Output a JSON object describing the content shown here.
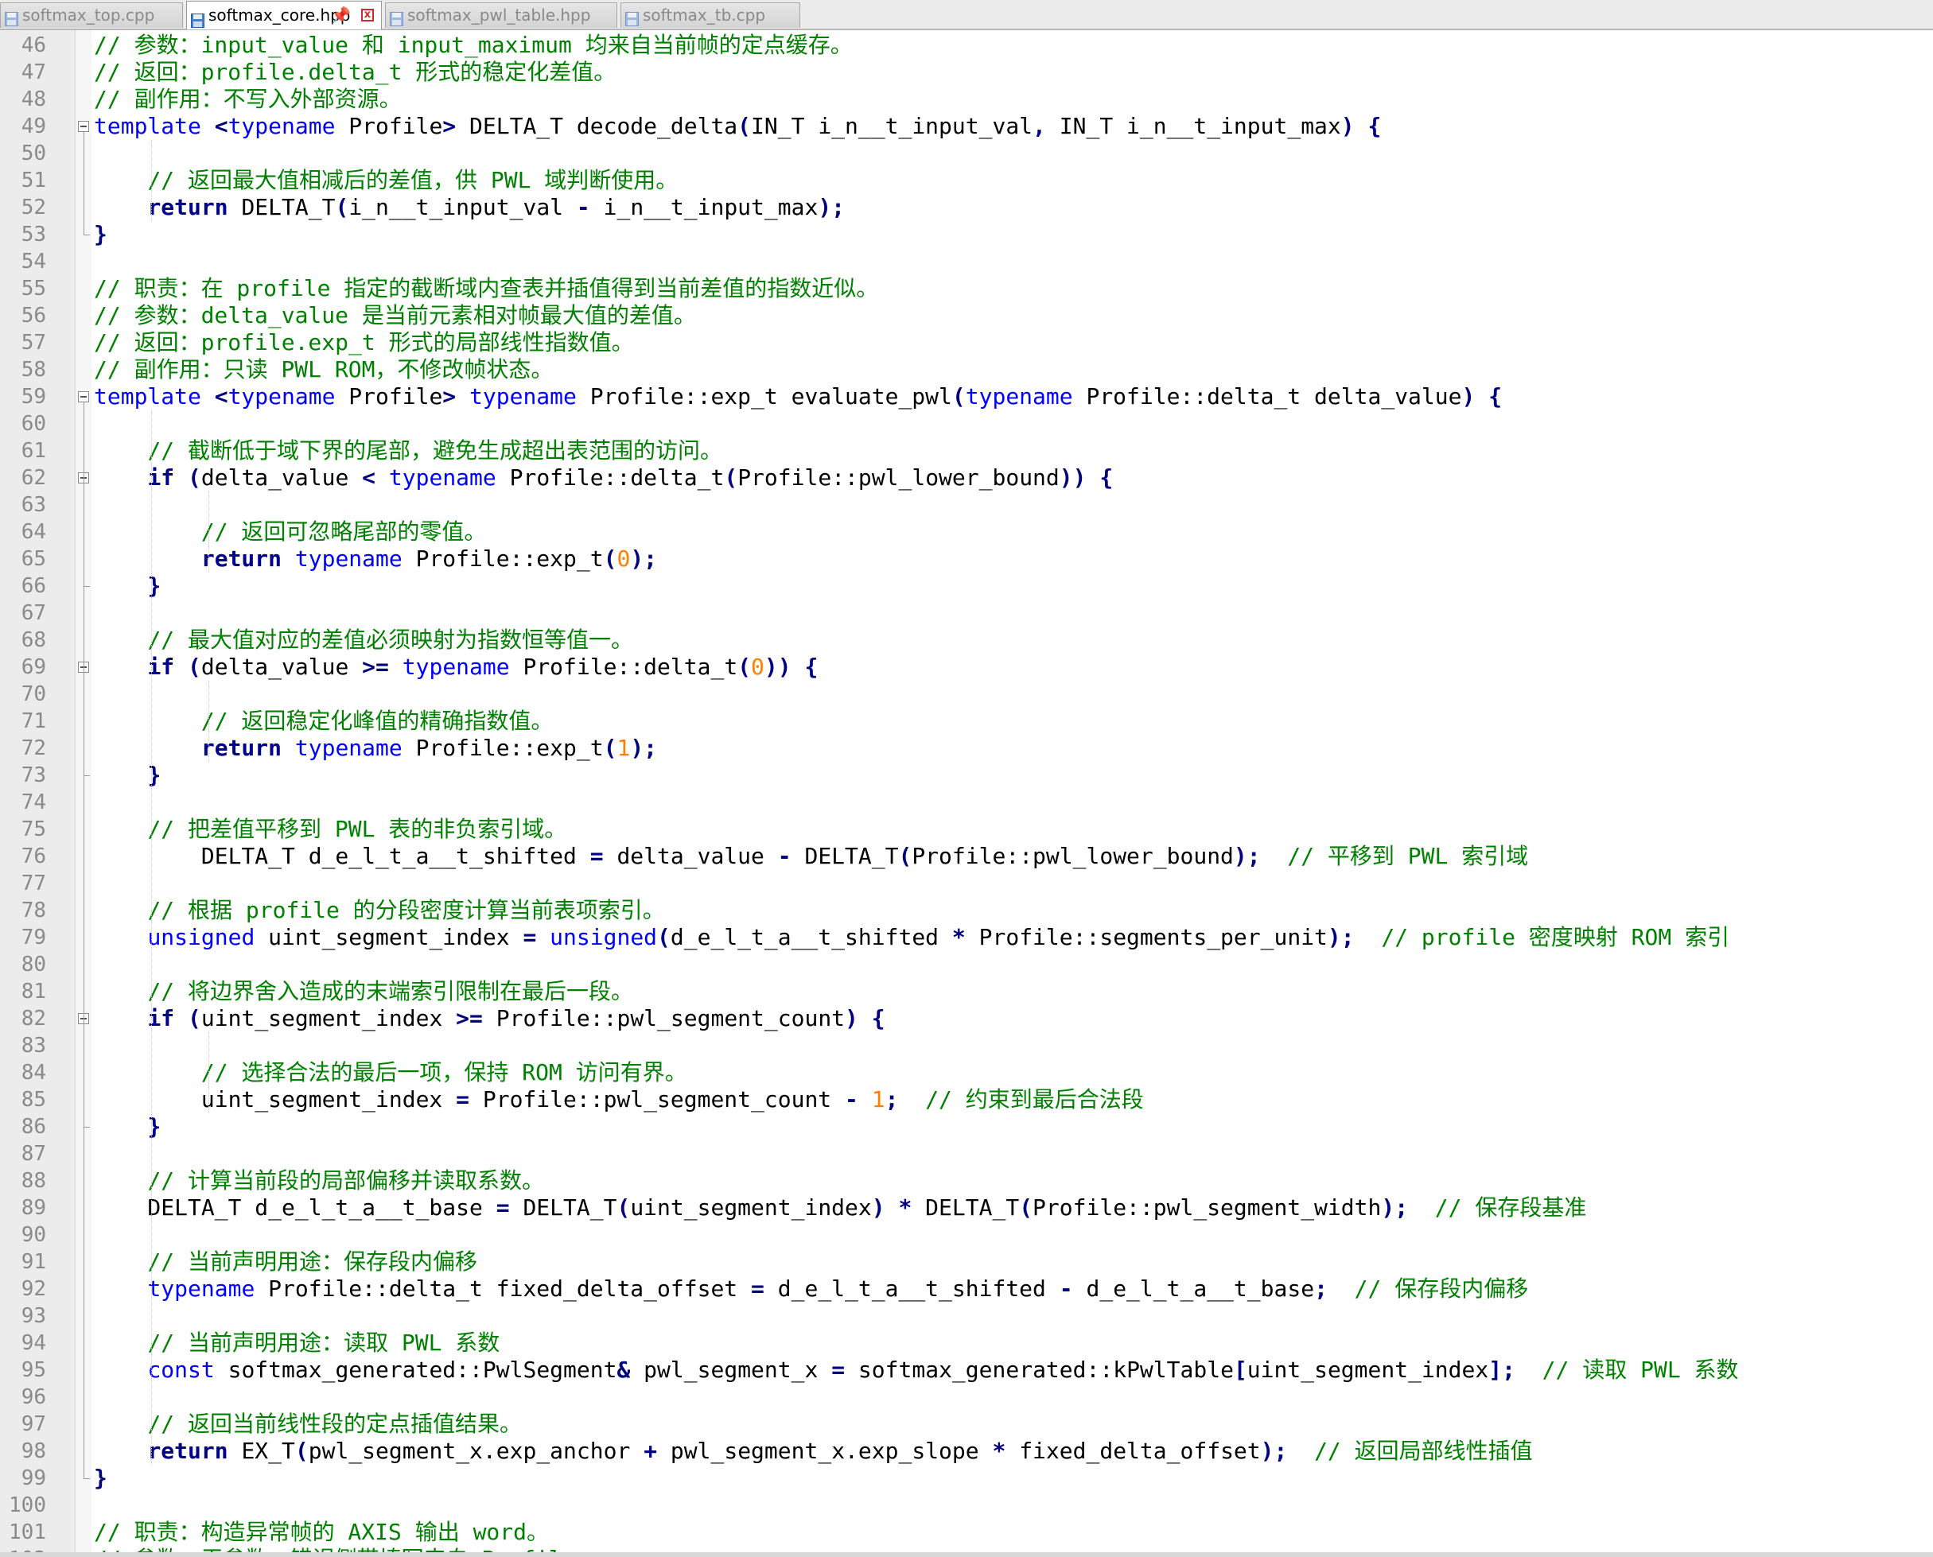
{
  "tabs": [
    {
      "label": "softmax_top.cpp",
      "active": false,
      "icon": "file-icon"
    },
    {
      "label": "softmax_core.hpp",
      "active": true,
      "icon": "save-icon",
      "pin": "📌",
      "close": "x"
    },
    {
      "label": "softmax_pwl_table.hpp",
      "active": false,
      "icon": "file-icon"
    },
    {
      "label": "softmax_tb.cpp",
      "active": false,
      "icon": "file-icon"
    }
  ],
  "colors": {
    "comment": "#008000",
    "keyword": "#0000ff",
    "bold_keyword": "#00008b",
    "number": "#ff8000",
    "operator": "#000080",
    "tab_close": "#d62828"
  },
  "lines": [
    {
      "n": "46",
      "t": [
        [
          "cm",
          "// 参数：input_value 和 input_maximum 均来自当前帧的定点缓存。"
        ]
      ]
    },
    {
      "n": "47",
      "t": [
        [
          "cm",
          "// 返回：profile.delta_t 形式的稳定化差值。"
        ]
      ]
    },
    {
      "n": "48",
      "t": [
        [
          "cm",
          "// 副作用：不写入外部资源。"
        ]
      ]
    },
    {
      "n": "49",
      "t": [
        [
          "kw",
          "template"
        ],
        [
          "",
          " "
        ],
        [
          "op",
          "<"
        ],
        [
          "kw",
          "typename"
        ],
        [
          "",
          " Profile"
        ],
        [
          "op",
          ">"
        ],
        [
          "",
          " DELTA_T decode_delta"
        ],
        [
          "op",
          "("
        ],
        [
          "",
          "IN_T i_n__t_input_val"
        ],
        [
          "op",
          ","
        ],
        [
          "",
          " IN_T i_n__t_input_max"
        ],
        [
          "op",
          ")"
        ],
        [
          "",
          " "
        ],
        [
          "op",
          "{"
        ]
      ]
    },
    {
      "n": "50",
      "t": []
    },
    {
      "n": "51",
      "t": [
        [
          "",
          "    "
        ],
        [
          "cm",
          "// 返回最大值相减后的差值，供 PWL 域判断使用。"
        ]
      ]
    },
    {
      "n": "52",
      "t": [
        [
          "",
          "    "
        ],
        [
          "kb",
          "return"
        ],
        [
          "",
          " DELTA_T"
        ],
        [
          "op",
          "("
        ],
        [
          "",
          "i_n__t_input_val "
        ],
        [
          "op",
          "-"
        ],
        [
          "",
          " i_n__t_input_max"
        ],
        [
          "op",
          ");"
        ]
      ]
    },
    {
      "n": "53",
      "t": [
        [
          "op",
          "}"
        ]
      ]
    },
    {
      "n": "54",
      "t": []
    },
    {
      "n": "55",
      "t": [
        [
          "cm",
          "// 职责：在 profile 指定的截断域内查表并插值得到当前差值的指数近似。"
        ]
      ]
    },
    {
      "n": "56",
      "t": [
        [
          "cm",
          "// 参数：delta_value 是当前元素相对帧最大值的差值。"
        ]
      ]
    },
    {
      "n": "57",
      "t": [
        [
          "cm",
          "// 返回：profile.exp_t 形式的局部线性指数值。"
        ]
      ]
    },
    {
      "n": "58",
      "t": [
        [
          "cm",
          "// 副作用：只读 PWL ROM，不修改帧状态。"
        ]
      ]
    },
    {
      "n": "59",
      "t": [
        [
          "kw",
          "template"
        ],
        [
          "",
          " "
        ],
        [
          "op",
          "<"
        ],
        [
          "kw",
          "typename"
        ],
        [
          "",
          " Profile"
        ],
        [
          "op",
          ">"
        ],
        [
          "",
          " "
        ],
        [
          "kw",
          "typename"
        ],
        [
          "",
          " Profile::exp_t evaluate_pwl"
        ],
        [
          "op",
          "("
        ],
        [
          "kw",
          "typename"
        ],
        [
          "",
          " Profile::delta_t delta_value"
        ],
        [
          "op",
          ")"
        ],
        [
          "",
          " "
        ],
        [
          "op",
          "{"
        ]
      ]
    },
    {
      "n": "60",
      "t": []
    },
    {
      "n": "61",
      "t": [
        [
          "",
          "    "
        ],
        [
          "cm",
          "// 截断低于域下界的尾部，避免生成超出表范围的访问。"
        ]
      ]
    },
    {
      "n": "62",
      "t": [
        [
          "",
          "    "
        ],
        [
          "kb",
          "if"
        ],
        [
          "",
          " "
        ],
        [
          "op",
          "("
        ],
        [
          "",
          "delta_value "
        ],
        [
          "op",
          "<"
        ],
        [
          "",
          " "
        ],
        [
          "kw",
          "typename"
        ],
        [
          "",
          " Profile::delta_t"
        ],
        [
          "op",
          "("
        ],
        [
          "",
          "Profile::pwl_lower_bound"
        ],
        [
          "op",
          "))"
        ],
        [
          "",
          " "
        ],
        [
          "op",
          "{"
        ]
      ]
    },
    {
      "n": "63",
      "t": []
    },
    {
      "n": "64",
      "t": [
        [
          "",
          "        "
        ],
        [
          "cm",
          "// 返回可忽略尾部的零值。"
        ]
      ]
    },
    {
      "n": "65",
      "t": [
        [
          "",
          "        "
        ],
        [
          "kb",
          "return"
        ],
        [
          "",
          " "
        ],
        [
          "kw",
          "typename"
        ],
        [
          "",
          " Profile::exp_t"
        ],
        [
          "op",
          "("
        ],
        [
          "num",
          "0"
        ],
        [
          "op",
          ");"
        ]
      ]
    },
    {
      "n": "66",
      "t": [
        [
          "",
          "    "
        ],
        [
          "op",
          "}"
        ]
      ]
    },
    {
      "n": "67",
      "t": []
    },
    {
      "n": "68",
      "t": [
        [
          "",
          "    "
        ],
        [
          "cm",
          "// 最大值对应的差值必须映射为指数恒等值一。"
        ]
      ]
    },
    {
      "n": "69",
      "t": [
        [
          "",
          "    "
        ],
        [
          "kb",
          "if"
        ],
        [
          "",
          " "
        ],
        [
          "op",
          "("
        ],
        [
          "",
          "delta_value "
        ],
        [
          "op",
          ">="
        ],
        [
          "",
          " "
        ],
        [
          "kw",
          "typename"
        ],
        [
          "",
          " Profile::delta_t"
        ],
        [
          "op",
          "("
        ],
        [
          "num",
          "0"
        ],
        [
          "op",
          "))"
        ],
        [
          "",
          " "
        ],
        [
          "op",
          "{"
        ]
      ]
    },
    {
      "n": "70",
      "t": []
    },
    {
      "n": "71",
      "t": [
        [
          "",
          "        "
        ],
        [
          "cm",
          "// 返回稳定化峰值的精确指数值。"
        ]
      ]
    },
    {
      "n": "72",
      "t": [
        [
          "",
          "        "
        ],
        [
          "kb",
          "return"
        ],
        [
          "",
          " "
        ],
        [
          "kw",
          "typename"
        ],
        [
          "",
          " Profile::exp_t"
        ],
        [
          "op",
          "("
        ],
        [
          "num",
          "1"
        ],
        [
          "op",
          ");"
        ]
      ]
    },
    {
      "n": "73",
      "t": [
        [
          "",
          "    "
        ],
        [
          "op",
          "}"
        ]
      ]
    },
    {
      "n": "74",
      "t": []
    },
    {
      "n": "75",
      "t": [
        [
          "",
          "    "
        ],
        [
          "cm",
          "// 把差值平移到 PWL 表的非负索引域。"
        ]
      ]
    },
    {
      "n": "76",
      "t": [
        [
          "",
          "        DELTA_T d_e_l_t_a__t_shifted "
        ],
        [
          "op",
          "="
        ],
        [
          "",
          " delta_value "
        ],
        [
          "op",
          "-"
        ],
        [
          "",
          " DELTA_T"
        ],
        [
          "op",
          "("
        ],
        [
          "",
          "Profile::pwl_lower_bound"
        ],
        [
          "op",
          ");"
        ],
        [
          "",
          "  "
        ],
        [
          "cm",
          "// 平移到 PWL 索引域"
        ]
      ]
    },
    {
      "n": "77",
      "t": []
    },
    {
      "n": "78",
      "t": [
        [
          "",
          "    "
        ],
        [
          "cm",
          "// 根据 profile 的分段密度计算当前表项索引。"
        ]
      ]
    },
    {
      "n": "79",
      "t": [
        [
          "",
          "    "
        ],
        [
          "kw",
          "unsigned"
        ],
        [
          "",
          " uint_segment_index "
        ],
        [
          "op",
          "="
        ],
        [
          "",
          " "
        ],
        [
          "kw",
          "unsigned"
        ],
        [
          "op",
          "("
        ],
        [
          "",
          "d_e_l_t_a__t_shifted "
        ],
        [
          "op",
          "*"
        ],
        [
          "",
          " Profile::segments_per_unit"
        ],
        [
          "op",
          ");"
        ],
        [
          "",
          "  "
        ],
        [
          "cm",
          "// profile 密度映射 ROM 索引"
        ]
      ]
    },
    {
      "n": "80",
      "t": []
    },
    {
      "n": "81",
      "t": [
        [
          "",
          "    "
        ],
        [
          "cm",
          "// 将边界舍入造成的末端索引限制在最后一段。"
        ]
      ]
    },
    {
      "n": "82",
      "t": [
        [
          "",
          "    "
        ],
        [
          "kb",
          "if"
        ],
        [
          "",
          " "
        ],
        [
          "op",
          "("
        ],
        [
          "",
          "uint_segment_index "
        ],
        [
          "op",
          ">="
        ],
        [
          "",
          " Profile::pwl_segment_count"
        ],
        [
          "op",
          ")"
        ],
        [
          "",
          " "
        ],
        [
          "op",
          "{"
        ]
      ]
    },
    {
      "n": "83",
      "t": []
    },
    {
      "n": "84",
      "t": [
        [
          "",
          "        "
        ],
        [
          "cm",
          "// 选择合法的最后一项，保持 ROM 访问有界。"
        ]
      ]
    },
    {
      "n": "85",
      "t": [
        [
          "",
          "        uint_segment_index "
        ],
        [
          "op",
          "="
        ],
        [
          "",
          " Profile::pwl_segment_count "
        ],
        [
          "op",
          "-"
        ],
        [
          "",
          " "
        ],
        [
          "num",
          "1"
        ],
        [
          "op",
          ";"
        ],
        [
          "",
          "  "
        ],
        [
          "cm",
          "// 约束到最后合法段"
        ]
      ]
    },
    {
      "n": "86",
      "t": [
        [
          "",
          "    "
        ],
        [
          "op",
          "}"
        ]
      ]
    },
    {
      "n": "87",
      "t": []
    },
    {
      "n": "88",
      "t": [
        [
          "",
          "    "
        ],
        [
          "cm",
          "// 计算当前段的局部偏移并读取系数。"
        ]
      ]
    },
    {
      "n": "89",
      "t": [
        [
          "",
          "    DELTA_T d_e_l_t_a__t_base "
        ],
        [
          "op",
          "="
        ],
        [
          "",
          " DELTA_T"
        ],
        [
          "op",
          "("
        ],
        [
          "",
          "uint_segment_index"
        ],
        [
          "op",
          ")"
        ],
        [
          "",
          " "
        ],
        [
          "op",
          "*"
        ],
        [
          "",
          " DELTA_T"
        ],
        [
          "op",
          "("
        ],
        [
          "",
          "Profile::pwl_segment_width"
        ],
        [
          "op",
          ");"
        ],
        [
          "",
          "  "
        ],
        [
          "cm",
          "// 保存段基准"
        ]
      ]
    },
    {
      "n": "90",
      "t": []
    },
    {
      "n": "91",
      "t": [
        [
          "",
          "    "
        ],
        [
          "cm",
          "// 当前声明用途：保存段内偏移"
        ]
      ]
    },
    {
      "n": "92",
      "t": [
        [
          "",
          "    "
        ],
        [
          "kw",
          "typename"
        ],
        [
          "",
          " Profile::delta_t fixed_delta_offset "
        ],
        [
          "op",
          "="
        ],
        [
          "",
          " d_e_l_t_a__t_shifted "
        ],
        [
          "op",
          "-"
        ],
        [
          "",
          " d_e_l_t_a__t_base"
        ],
        [
          "op",
          ";"
        ],
        [
          "",
          "  "
        ],
        [
          "cm",
          "// 保存段内偏移"
        ]
      ]
    },
    {
      "n": "93",
      "t": []
    },
    {
      "n": "94",
      "t": [
        [
          "",
          "    "
        ],
        [
          "cm",
          "// 当前声明用途：读取 PWL 系数"
        ]
      ]
    },
    {
      "n": "95",
      "t": [
        [
          "",
          "    "
        ],
        [
          "kw",
          "const"
        ],
        [
          "",
          " softmax_generated::PwlSegment"
        ],
        [
          "op",
          "&"
        ],
        [
          "",
          " pwl_segment_x "
        ],
        [
          "op",
          "="
        ],
        [
          "",
          " softmax_generated::kPwlTable"
        ],
        [
          "op",
          "["
        ],
        [
          "",
          "uint_segment_index"
        ],
        [
          "op",
          "];"
        ],
        [
          "",
          "  "
        ],
        [
          "cm",
          "// 读取 PWL 系数"
        ]
      ]
    },
    {
      "n": "96",
      "t": []
    },
    {
      "n": "97",
      "t": [
        [
          "",
          "    "
        ],
        [
          "cm",
          "// 返回当前线性段的定点插值结果。"
        ]
      ]
    },
    {
      "n": "98",
      "t": [
        [
          "",
          "    "
        ],
        [
          "kb",
          "return"
        ],
        [
          "",
          " EX_T"
        ],
        [
          "op",
          "("
        ],
        [
          "",
          "pwl_segment_x.exp_anchor "
        ],
        [
          "op",
          "+"
        ],
        [
          "",
          " pwl_segment_x.exp_slope "
        ],
        [
          "op",
          "*"
        ],
        [
          "",
          " fixed_delta_offset"
        ],
        [
          "op",
          ");"
        ],
        [
          "",
          "  "
        ],
        [
          "cm",
          "// 返回局部线性插值"
        ]
      ]
    },
    {
      "n": "99",
      "t": [
        [
          "op",
          "}"
        ]
      ]
    },
    {
      "n": "100",
      "t": []
    },
    {
      "n": "101",
      "t": [
        [
          "cm",
          "// 职责：构造异常帧的 AXIS 输出 word。"
        ]
      ]
    },
    {
      "n": "102",
      "t": [
        [
          "cm",
          "// 参数：无参数；错误侧带填写来自 Profile"
        ]
      ]
    }
  ]
}
